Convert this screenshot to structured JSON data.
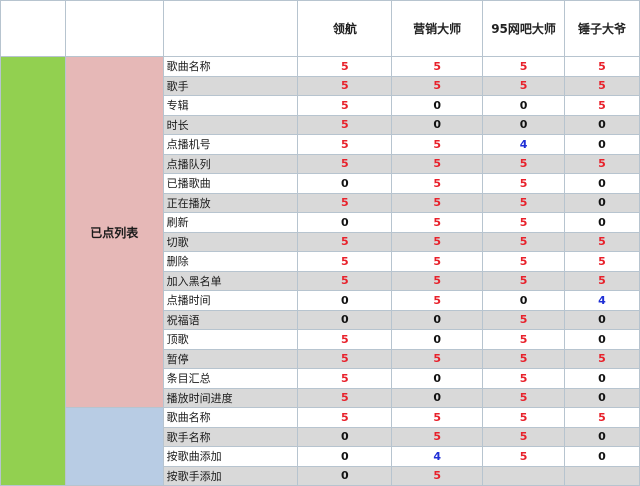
{
  "header": {
    "columns": [
      "领航",
      "营销大师",
      "95网吧大师",
      "锤子大爷"
    ]
  },
  "groups": [
    {
      "label": "已点列表",
      "rows": [
        {
          "feature": "歌曲名称",
          "values": [
            "5",
            "5",
            "5",
            "5"
          ]
        },
        {
          "feature": "歌手",
          "values": [
            "5",
            "5",
            "5",
            "5"
          ]
        },
        {
          "feature": "专辑",
          "values": [
            "5",
            "0",
            "0",
            "5"
          ]
        },
        {
          "feature": "时长",
          "values": [
            "5",
            "0",
            "0",
            "0"
          ]
        },
        {
          "feature": "点播机号",
          "values": [
            "5",
            "5",
            "4",
            "0"
          ]
        },
        {
          "feature": "点播队列",
          "values": [
            "5",
            "5",
            "5",
            "5"
          ]
        },
        {
          "feature": "已播歌曲",
          "values": [
            "0",
            "5",
            "5",
            "0"
          ]
        },
        {
          "feature": "正在播放",
          "values": [
            "5",
            "5",
            "5",
            "0"
          ]
        },
        {
          "feature": "刷新",
          "values": [
            "0",
            "5",
            "5",
            "0"
          ]
        },
        {
          "feature": "切歌",
          "values": [
            "5",
            "5",
            "5",
            "5"
          ]
        },
        {
          "feature": "删除",
          "values": [
            "5",
            "5",
            "5",
            "5"
          ]
        },
        {
          "feature": "加入黑名单",
          "values": [
            "5",
            "5",
            "5",
            "5"
          ]
        },
        {
          "feature": "点播时间",
          "values": [
            "0",
            "5",
            "0",
            "4"
          ]
        },
        {
          "feature": "祝福语",
          "values": [
            "0",
            "0",
            "5",
            "0"
          ]
        },
        {
          "feature": "顶歌",
          "values": [
            "5",
            "0",
            "5",
            "0"
          ]
        },
        {
          "feature": "暂停",
          "values": [
            "5",
            "5",
            "5",
            "5"
          ]
        },
        {
          "feature": "条目汇总",
          "values": [
            "5",
            "0",
            "5",
            "0"
          ]
        },
        {
          "feature": "播放时间进度",
          "values": [
            "5",
            "0",
            "5",
            "0"
          ]
        }
      ]
    },
    {
      "label": "",
      "rows": [
        {
          "feature": "歌曲名称",
          "values": [
            "5",
            "5",
            "5",
            "5"
          ]
        },
        {
          "feature": "歌手名称",
          "values": [
            "0",
            "5",
            "5",
            "0"
          ]
        },
        {
          "feature": "按歌曲添加",
          "values": [
            "0",
            "4",
            "5",
            "0"
          ]
        },
        {
          "feature": "按歌手添加",
          "values": [
            "0",
            "5",
            "",
            ""
          ]
        }
      ]
    }
  ],
  "colors": {
    "category_green": "#92d050",
    "group1_pink": "#e6b8b7",
    "group2_blue": "#b8cce4",
    "value_five_red": "#e8212b",
    "value_zero_black": "#111111",
    "value_four_blue": "#1f2fd6"
  }
}
